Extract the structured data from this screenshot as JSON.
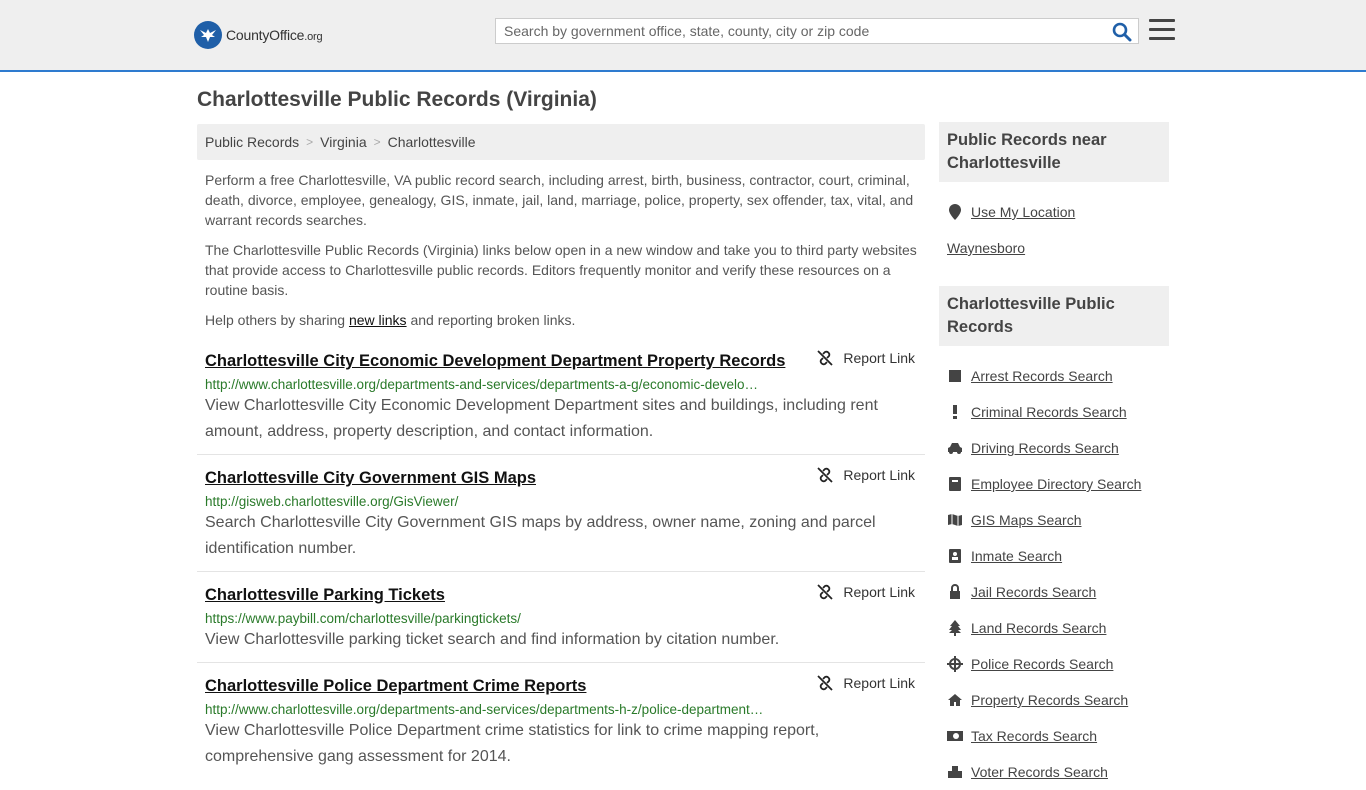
{
  "header": {
    "logo_text_main": "CountyOffice",
    "logo_text_tld": ".org",
    "search_placeholder": "Search by government office, state, county, city or zip code"
  },
  "page_title": "Charlottesville Public Records (Virginia)",
  "breadcrumb": [
    "Public Records",
    "Virginia",
    "Charlottesville"
  ],
  "intro": {
    "p1": "Perform a free Charlottesville, VA public record search, including arrest, birth, business, contractor, court, criminal, death, divorce, employee, genealogy, GIS, inmate, jail, land, marriage, police, property, sex offender, tax, vital, and warrant records searches.",
    "p2": "The Charlottesville Public Records (Virginia) links below open in a new window and take you to third party websites that provide access to Charlottesville public records. Editors frequently monitor and verify these resources on a routine basis.",
    "p3_before": "Help others by sharing ",
    "p3_link": "new links",
    "p3_after": " and reporting broken links."
  },
  "report_label": "Report Link",
  "results": [
    {
      "title": "Charlottesville City Economic Development Department Property Records",
      "url": "http://www.charlottesville.org/departments-and-services/departments-a-g/economic-develo…",
      "desc": "View Charlottesville City Economic Development Department sites and buildings, including rent amount, address, property description, and contact information."
    },
    {
      "title": "Charlottesville City Government GIS Maps",
      "url": "http://gisweb.charlottesville.org/GisViewer/",
      "desc": "Search Charlottesville City Government GIS maps by address, owner name, zoning and parcel identification number."
    },
    {
      "title": "Charlottesville Parking Tickets",
      "url": "https://www.paybill.com/charlottesville/parkingtickets/",
      "desc": "View Charlottesville parking ticket search and find information by citation number."
    },
    {
      "title": "Charlottesville Police Department Crime Reports",
      "url": "http://www.charlottesville.org/departments-and-services/departments-h-z/police-department…",
      "desc": "View Charlottesville Police Department crime statistics for link to crime mapping report, comprehensive gang assessment for 2014."
    }
  ],
  "sidebar": {
    "near_heading": "Public Records near Charlottesville",
    "use_location": "Use My Location",
    "near_places": [
      "Waynesboro"
    ],
    "records_heading": "Charlottesville Public Records",
    "records": [
      {
        "label": "Arrest Records Search",
        "icon": "square-icon"
      },
      {
        "label": "Criminal Records Search",
        "icon": "exclamation-icon"
      },
      {
        "label": "Driving Records Search",
        "icon": "car-icon"
      },
      {
        "label": "Employee Directory Search",
        "icon": "book-icon"
      },
      {
        "label": "GIS Maps Search",
        "icon": "map-icon"
      },
      {
        "label": "Inmate Search",
        "icon": "id-badge-icon"
      },
      {
        "label": "Jail Records Search",
        "icon": "lock-icon"
      },
      {
        "label": "Land Records Search",
        "icon": "tree-icon"
      },
      {
        "label": "Police Records Search",
        "icon": "crosshair-icon"
      },
      {
        "label": "Property Records Search",
        "icon": "home-icon"
      },
      {
        "label": "Tax Records Search",
        "icon": "money-icon"
      },
      {
        "label": "Voter Records Search",
        "icon": "vote-icon"
      }
    ]
  }
}
